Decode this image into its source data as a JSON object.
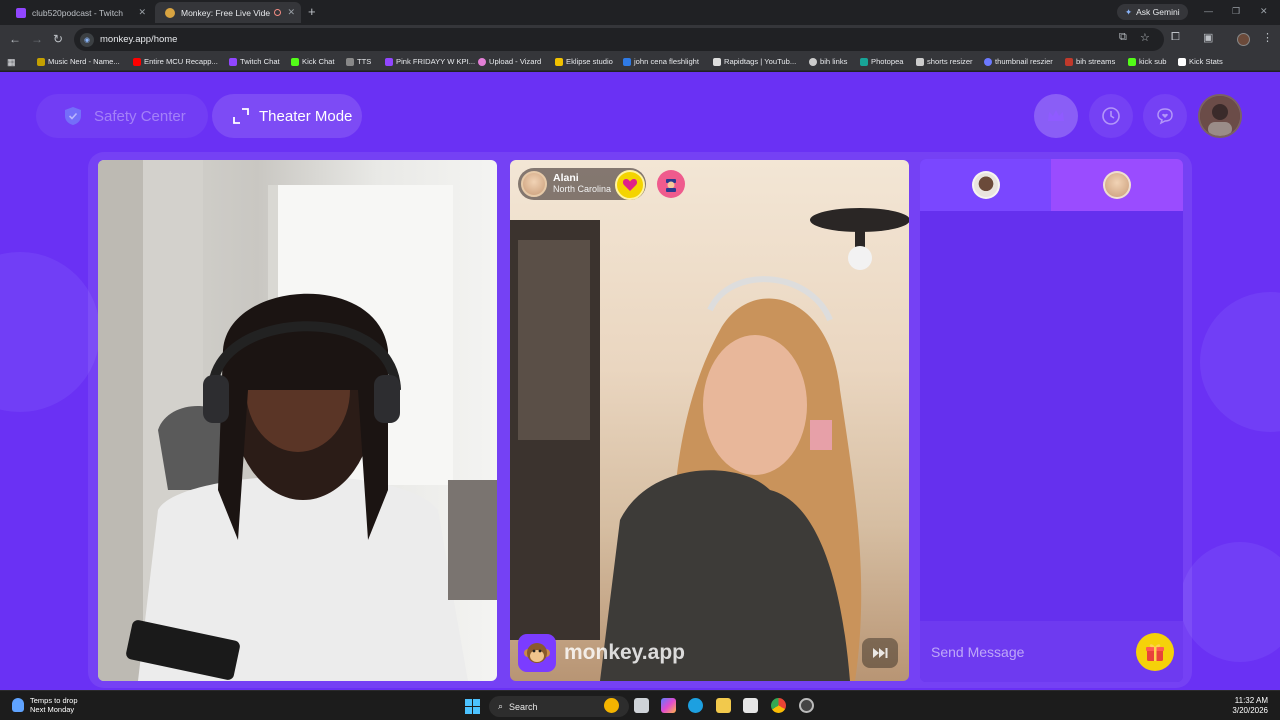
{
  "browser": {
    "tabs": [
      {
        "title": "club520podcast - Twitch",
        "active": false
      },
      {
        "title": "Monkey: Free Live Video Ch",
        "active": true
      }
    ],
    "ask_gemini": "Ask Gemini",
    "url": "monkey.app/home",
    "bookmarks": [
      "Music Nerd - Name...",
      "Entire MCU Recapp...",
      "Twitch Chat",
      "Kick Chat",
      "TTS",
      "Pink FRIDAYY W KPI...",
      "Upload - Vizard",
      "Eklipse studio",
      "john cena fleshlight",
      "Rapidtags | YouTub...",
      "bih links",
      "Photopea",
      "shorts resizer",
      "thumbnail reszier",
      "bih streams",
      "kick sub",
      "Kick Stats"
    ]
  },
  "page": {
    "safety_center": "Safety Center",
    "theater_mode": "Theater Mode",
    "peer": {
      "name": "Alani",
      "location": "North Carolina"
    },
    "watermark": "monkey.app",
    "chat": {
      "placeholder": "Send Message"
    }
  },
  "taskbar": {
    "weather_title": "Temps to drop",
    "weather_sub": "Next Monday",
    "search": "Search",
    "time": "11:32 AM",
    "date": "3/20/2026"
  },
  "colors": {
    "accent": "#6a31f4",
    "heart": "#f4d400",
    "report": "#ef5b8d",
    "gift": "#f5d10a"
  }
}
